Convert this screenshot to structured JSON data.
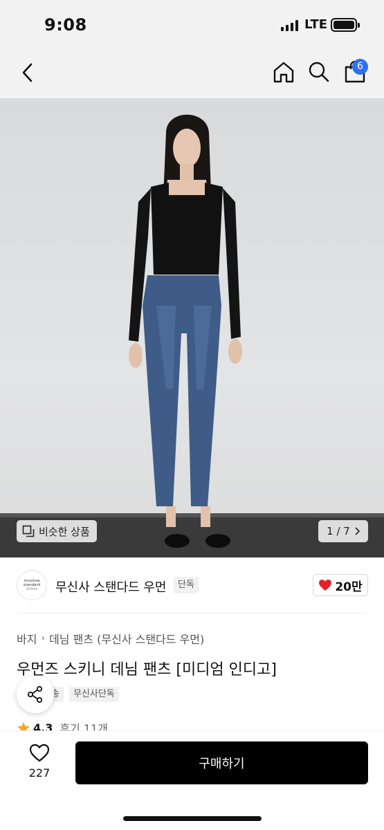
{
  "status_bar": {
    "time": "9:08",
    "network": "LTE"
  },
  "nav": {
    "cart_count": "6"
  },
  "hero": {
    "similar_label": "비슷한 상품",
    "pager": "1 / 7"
  },
  "brand": {
    "logo_line1": "musinsa",
    "logo_line2": "standard",
    "logo_line3": "WOMAN",
    "name": "무신사 스탠다드 우먼",
    "exclusive_tag": "단독",
    "like_count": "20만"
  },
  "product": {
    "breadcrumb": [
      "바지",
      "데님 팬츠 (무신사 스탠다드 우먼)"
    ],
    "title": "우먼즈 스키니 데님 팬츠 [미디엄 인디고]",
    "tags": [
      "송",
      "무신사단독"
    ],
    "rating": "4.3",
    "reviews": "후기 11개"
  },
  "bottom": {
    "wish_count": "227",
    "buy_label": "구매하기"
  },
  "colors": {
    "accent_badge": "#2f6ff0",
    "heart": "#e5202c",
    "star": "#f5a623",
    "buy_button": "#000000"
  }
}
